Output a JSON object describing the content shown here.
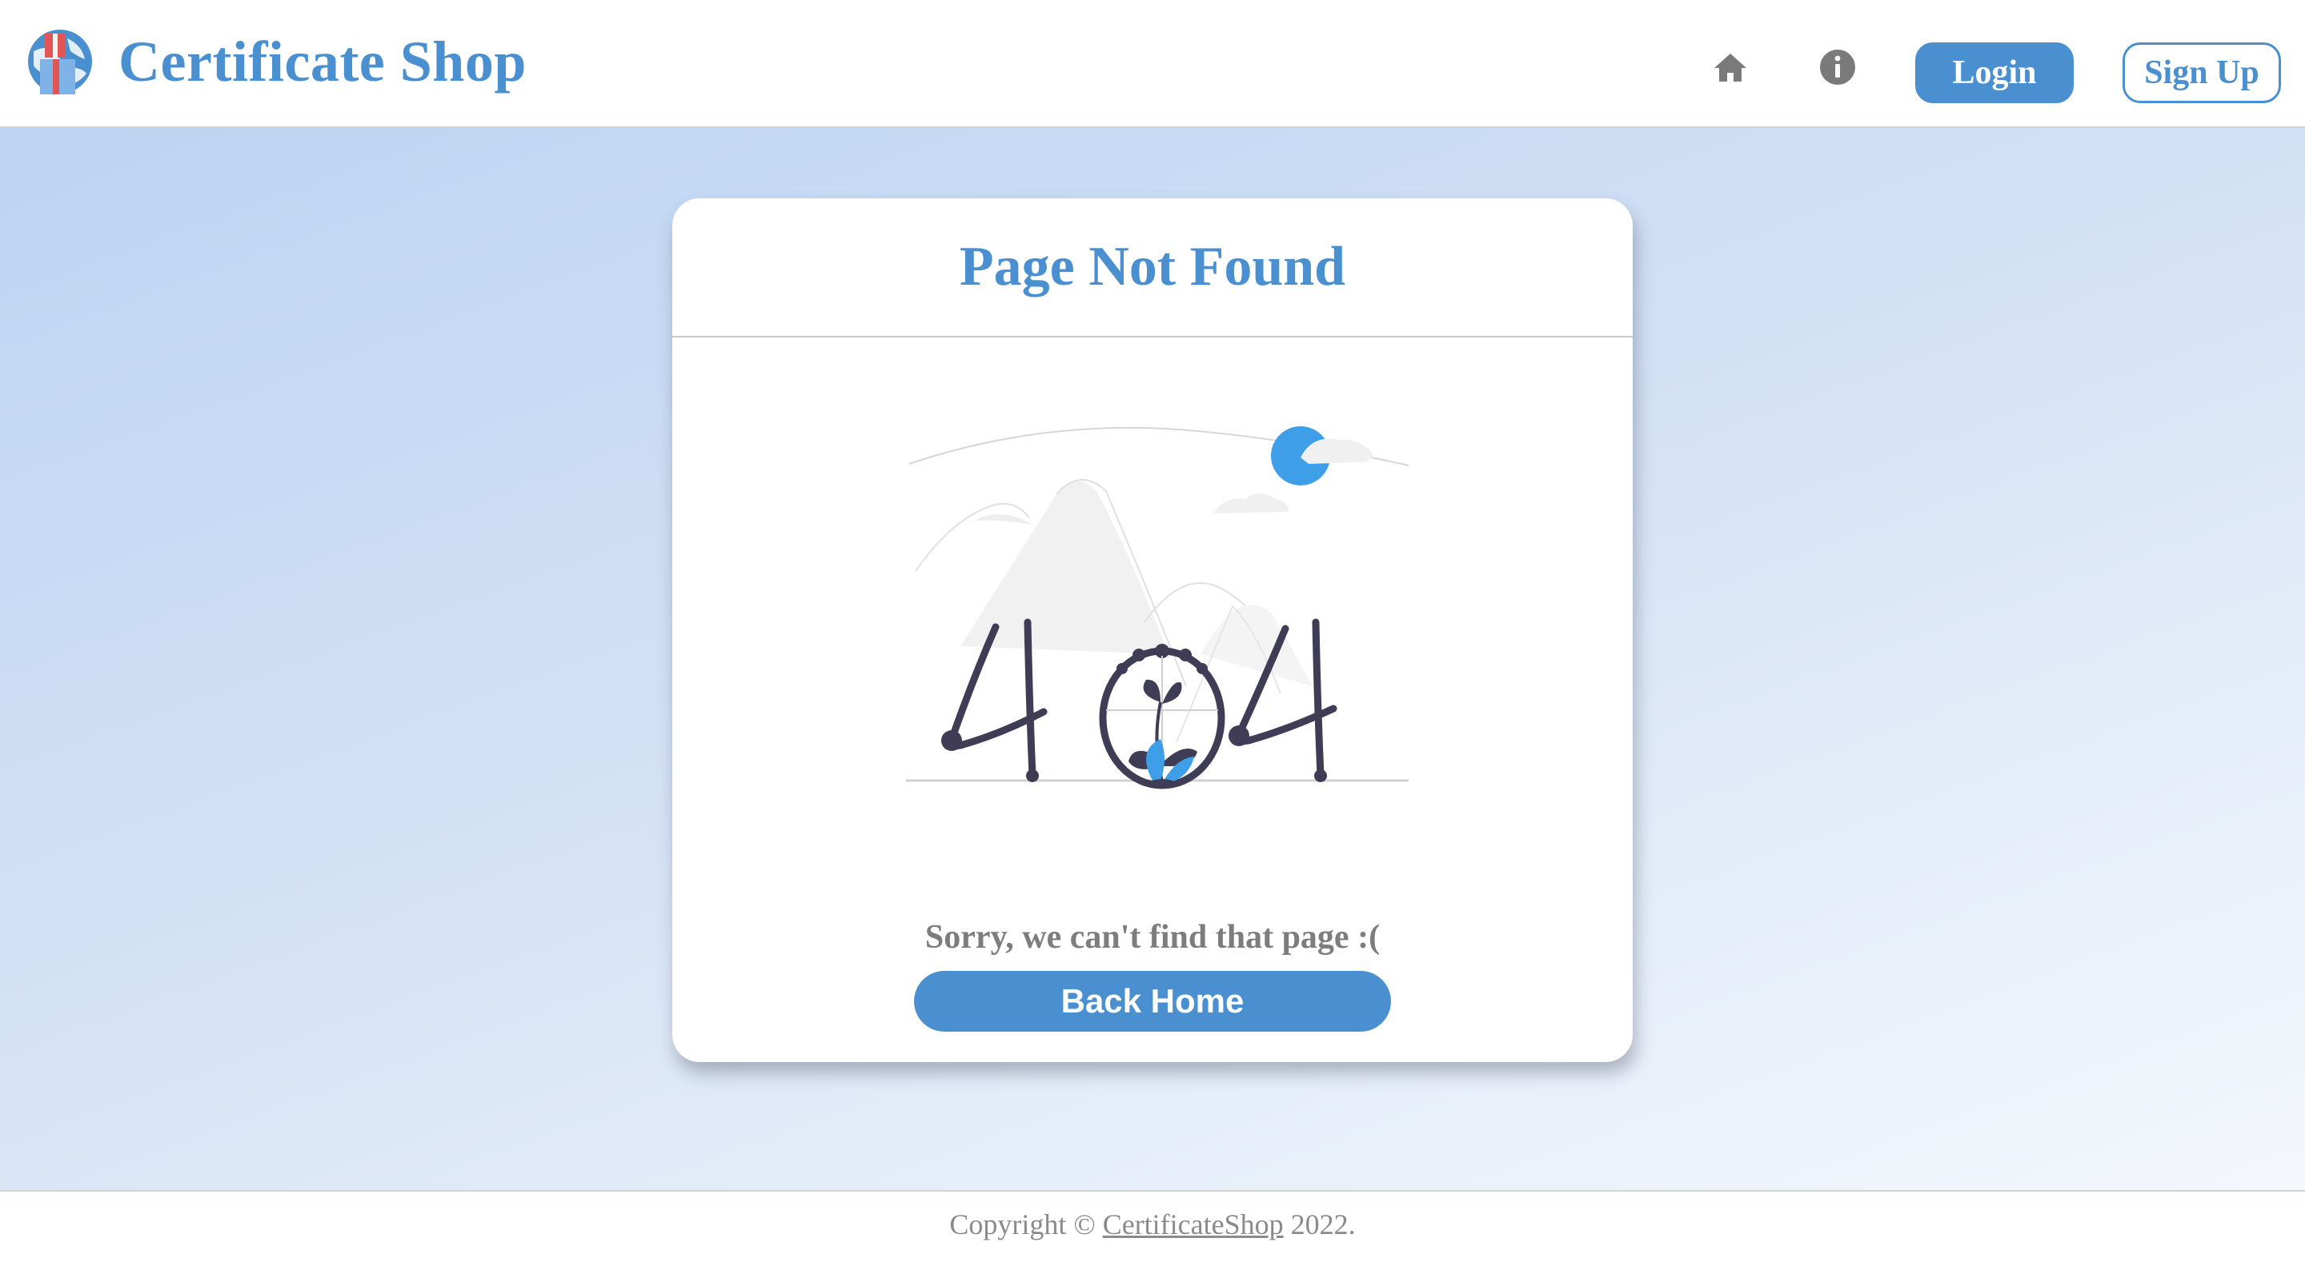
{
  "header": {
    "brand_name": "Certificate Shop",
    "logo_icon": "globe-gift-icon",
    "home_icon": "home-icon",
    "info_icon": "info-icon",
    "login_label": "Login",
    "signup_label": "Sign Up"
  },
  "card": {
    "title": "Page Not Found",
    "illustration": "404-illustration",
    "message": "Sorry, we can't find that page :(",
    "button_label": "Back Home"
  },
  "footer": {
    "prefix": "Copyright ©",
    "link_text": "CertificateShop",
    "suffix": "2022."
  },
  "colors": {
    "accent": "#4a90d0",
    "text_muted": "#7d7d7d",
    "illustration_dark": "#3f3d56",
    "illustration_blue": "#3f9ee8"
  }
}
